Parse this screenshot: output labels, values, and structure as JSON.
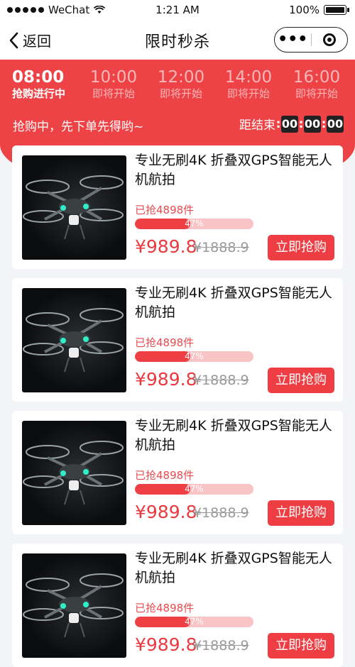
{
  "status_bar": {
    "carrier": "WeChat",
    "time": "1:21 AM",
    "battery": "100%"
  },
  "nav": {
    "back_label": "返回",
    "title": "限时秒杀"
  },
  "time_slots": [
    {
      "time": "08:00",
      "status": "抢购进行中",
      "active": true
    },
    {
      "time": "10:00",
      "status": "即将开始",
      "active": false
    },
    {
      "time": "12:00",
      "status": "即将开始",
      "active": false
    },
    {
      "time": "14:00",
      "status": "即将开始",
      "active": false
    },
    {
      "time": "16:00",
      "status": "即将开始",
      "active": false
    }
  ],
  "banner": {
    "notice": "抢购中，先下单先得哟~",
    "countdown_label": "距结束",
    "hours": "00",
    "minutes": "00",
    "seconds": "00"
  },
  "colors": {
    "accent": "#ee4346",
    "background": "#f2f4f8"
  },
  "products": [
    {
      "title": "专业无刷4K 折叠双GPS智能无人机航拍",
      "sold": "已抢4898件",
      "progress_label": "47%",
      "progress": 0.47,
      "price": "¥989.8",
      "original_price": "¥1888.9",
      "buy_label": "立即抢购"
    },
    {
      "title": "专业无刷4K 折叠双GPS智能无人机航拍",
      "sold": "已抢4898件",
      "progress_label": "47%",
      "progress": 0.47,
      "price": "¥989.8",
      "original_price": "¥1888.9",
      "buy_label": "立即抢购"
    },
    {
      "title": "专业无刷4K 折叠双GPS智能无人机航拍",
      "sold": "已抢4898件",
      "progress_label": "47%",
      "progress": 0.47,
      "price": "¥989.8",
      "original_price": "¥1888.9",
      "buy_label": "立即抢购"
    },
    {
      "title": "专业无刷4K 折叠双GPS智能无人机航拍",
      "sold": "已抢4898件",
      "progress_label": "47%",
      "progress": 0.47,
      "price": "¥989.8",
      "original_price": "¥1888.9",
      "buy_label": "立即抢购"
    }
  ]
}
